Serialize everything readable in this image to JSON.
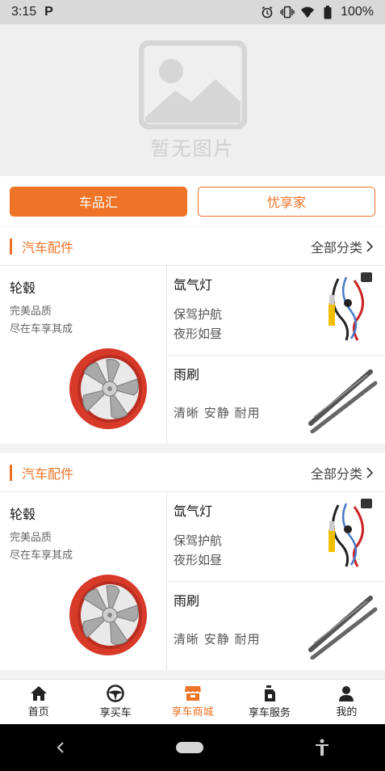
{
  "status_bar": {
    "time": "3:15",
    "app_icon": "P",
    "battery": "100%"
  },
  "banner": {
    "placeholder_text": "暂无图片"
  },
  "toggles": {
    "active": "车品汇",
    "inactive": "忧享家"
  },
  "sections": [
    {
      "title": "汽车配件",
      "more": "全部分类",
      "left": {
        "title": "轮毂",
        "line1": "完美品质",
        "line2": "尽在车享其成"
      },
      "right_top": {
        "title": "氙气灯",
        "line1": "保驾护航",
        "line2": "夜形如昼"
      },
      "right_bottom": {
        "title": "雨刷",
        "desc": "清晰  安静  耐用"
      }
    },
    {
      "title": "汽车配件",
      "more": "全部分类",
      "left": {
        "title": "轮毂",
        "line1": "完美品质",
        "line2": "尽在车享其成"
      },
      "right_top": {
        "title": "氙气灯",
        "line1": "保驾护航",
        "line2": "夜形如昼"
      },
      "right_bottom": {
        "title": "雨刷",
        "desc": "清晰  安静  耐用"
      }
    }
  ],
  "bottom_nav": [
    {
      "label": "首页",
      "icon": "home-icon"
    },
    {
      "label": "享买车",
      "icon": "steering-wheel-icon"
    },
    {
      "label": "享车商城",
      "icon": "store-icon",
      "active": true
    },
    {
      "label": "享车服务",
      "icon": "oil-can-icon"
    },
    {
      "label": "我的",
      "icon": "person-icon"
    }
  ],
  "colors": {
    "accent": "#ee7326"
  }
}
